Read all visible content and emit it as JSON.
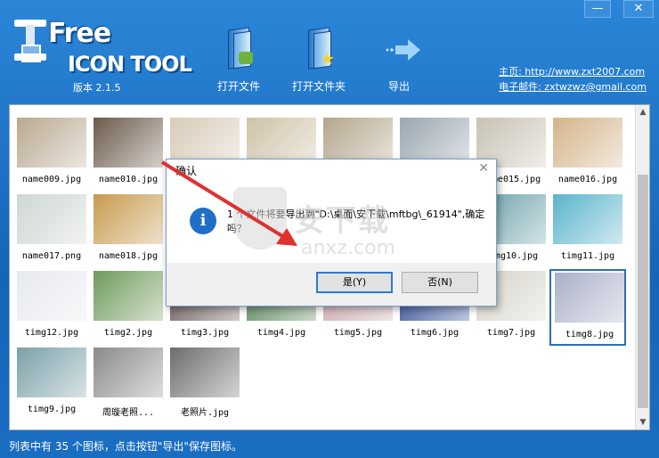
{
  "header": {
    "logo_free": "Free",
    "logo_tool": "ICON TOOL",
    "version": "版本 2.1.5",
    "buttons": [
      {
        "label": "打开文件",
        "icon": "open-file-icon"
      },
      {
        "label": "打开文件夹",
        "icon": "open-folder-icon"
      },
      {
        "label": "导出",
        "icon": "export-icon"
      }
    ],
    "homepage": "主页: http://www.zxt2007.com",
    "email": "电子邮件: zxtwzwz@gmail.com",
    "window_controls": {
      "minimize": "—",
      "close": "✕"
    }
  },
  "files": [
    {
      "name": "name009.jpg",
      "color": "#b8a890"
    },
    {
      "name": "name010.jpg",
      "color": "#6b5a4a"
    },
    {
      "name": "",
      "color": "#d8cbb8"
    },
    {
      "name": "",
      "color": "#cfc3a8"
    },
    {
      "name": "",
      "color": "#b4a68c"
    },
    {
      "name": "",
      "color": "#9aa6b0"
    },
    {
      "name": "name015.jpg",
      "color": "#c8c2b4"
    },
    {
      "name": "name016.jpg",
      "color": "#d4b48a"
    },
    {
      "name": "name017.png",
      "color": "#cfd6d0"
    },
    {
      "name": "name018.jpg",
      "color": "#c79a4e"
    },
    {
      "name": "",
      "color": "#ffffff"
    },
    {
      "name": "",
      "color": "#ffffff"
    },
    {
      "name": "",
      "color": "#ffffff"
    },
    {
      "name": "",
      "color": "#ffffff"
    },
    {
      "name": "timg10.jpg",
      "color": "#6aa0a8"
    },
    {
      "name": "timg11.jpg",
      "color": "#5ab4cc"
    },
    {
      "name": "timg12.jpg",
      "color": "#e8e8f0"
    },
    {
      "name": "timg2.jpg",
      "color": "#6f9a5a"
    },
    {
      "name": "timg3.jpg",
      "color": "#5b4848"
    },
    {
      "name": "timg4.jpg",
      "color": "#4a7a4a"
    },
    {
      "name": "timg5.jpg",
      "color": "#c8a0a8"
    },
    {
      "name": "timg6.jpg",
      "color": "#1e3e8a"
    },
    {
      "name": "timg7.jpg",
      "color": "#d6d2c8"
    },
    {
      "name": "timg8.jpg",
      "color": "#aab0c8"
    },
    {
      "name": "timg9.jpg",
      "color": "#7aa0a8"
    },
    {
      "name": "周璇老照...",
      "color": "#8a8a8a"
    },
    {
      "name": "老照片.jpg",
      "color": "#6c6c6c"
    }
  ],
  "selected_file": "timg8.jpg",
  "dialog": {
    "title": "确认",
    "message": "1 个文件将要导出到\"D:\\桌面\\安下载\\mftbg\\_61914\",确定吗？",
    "yes_label": "是(Y)",
    "no_label": "否(N)",
    "close": "✕"
  },
  "watermark": {
    "text": "安下载",
    "sub": "anxz.com"
  },
  "status": "列表中有 35 个图标，点击按钮\"导出\"保存图标。"
}
